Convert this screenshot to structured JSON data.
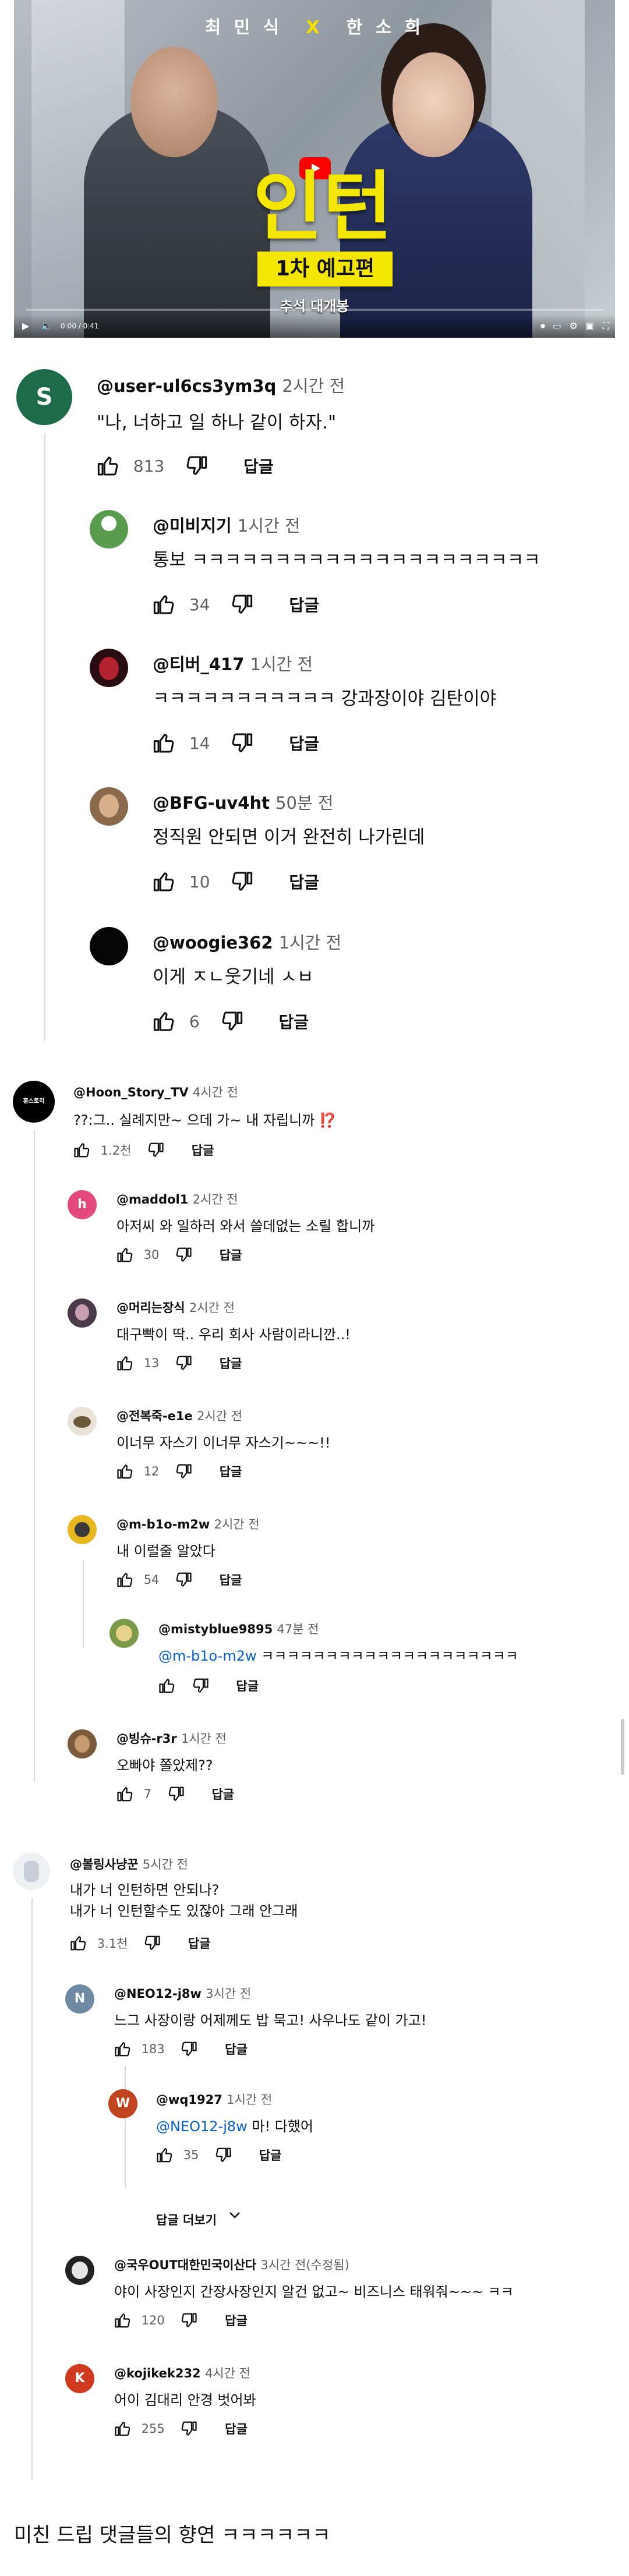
{
  "video": {
    "cast_left": "최 민 식",
    "cast_x": "X",
    "cast_right": "한 소 희",
    "title": "인턴",
    "subtitle": "1차 예고편",
    "caption": "추석 대개봉",
    "time": "0:00 / 0:41"
  },
  "section1": {
    "top": {
      "author": "@user-ul6cs3ym3q",
      "time": "2시간 전",
      "text": "\"나, 너하고 일 하나 같이 하자.\"",
      "likes": "813",
      "reply": "답글"
    },
    "replies": [
      {
        "author": "@미비지기",
        "time": "1시간 전",
        "text": "통보 ㅋㅋㅋㅋㅋㅋㅋㅋㅋㅋㅋㅋㅋㅋㅋㅋㅋㅋㅋㅋㅋ",
        "likes": "34",
        "reply": "답글"
      },
      {
        "author": "@티버_417",
        "time": "1시간 전",
        "text": "ㅋㅋㅋㅋㅋㅋㅋㅋㅋㅋㅋ 강과장이야 김탄이야",
        "likes": "14",
        "reply": "답글"
      },
      {
        "author": "@BFG-uv4ht",
        "time": "50분 전",
        "text": "정직원 안되면 이거 완전히 나가린데",
        "likes": "10",
        "reply": "답글"
      },
      {
        "author": "@woogie362",
        "time": "1시간 전",
        "text": "이게 ㅈㄴ웃기네 ㅅㅂ",
        "likes": "6",
        "reply": "답글"
      }
    ]
  },
  "section2": {
    "top": {
      "author": "@Hoon_Story_TV",
      "time": "4시간 전",
      "text": "??:그.. 실례지만~ 으데 가~ 내 자립니까",
      "emoji": "⁉️",
      "likes": "1.2천",
      "reply": "답글",
      "avatar_text": "훈스토리"
    },
    "replies": [
      {
        "author": "@maddol1",
        "time": "2시간 전",
        "text": "아저씨 와 일하러 와서 쓸데없는 소릴 합니까",
        "likes": "30",
        "reply": "답글",
        "initial": "h"
      },
      {
        "author": "@머리는장식",
        "time": "2시간 전",
        "text": "대구빡이 딱.. 우리 회사 사람이라니깐..!",
        "likes": "13",
        "reply": "답글"
      },
      {
        "author": "@전복죽-e1e",
        "time": "2시간 전",
        "text": "이너무 자스기 이너무 자스기~~~!!",
        "likes": "12",
        "reply": "답글"
      },
      {
        "author": "@m-b1o-m2w",
        "time": "2시간 전",
        "text": "내 이럴줄 알았다",
        "likes": "54",
        "reply": "답글"
      }
    ],
    "nested": {
      "author": "@mistyblue9895",
      "time": "47분 전",
      "mention": "@m-b1o-m2w",
      "text": "ㅋㅋㅋㅋㅋㅋㅋㅋㅋㅋㅋㅋㅋㅋㅋㅋㅋㅋㅋㅋ",
      "reply": "답글"
    },
    "last": {
      "author": "@빙슈-r3r",
      "time": "1시간 전",
      "text": "오빠야 쫄았제??",
      "likes": "7",
      "reply": "답글"
    }
  },
  "section3": {
    "top": {
      "author": "@볼링사냥꾼",
      "time": "5시간 전",
      "line1": "내가 너 인턴하면 안되나?",
      "line2": "내가 너 인턴할수도 있잖아 그래 안그래",
      "likes": "3.1천",
      "reply": "답글"
    },
    "r1": {
      "author": "@NEO12-j8w",
      "time": "3시간 전",
      "text": "느그 사장이랑 어제께도 밥 묵고! 사우나도 같이 가고!",
      "likes": "183",
      "reply": "답글",
      "initial": "N"
    },
    "r1_nested": {
      "author": "@wq1927",
      "time": "1시간 전",
      "mention": "@NEO12-j8w",
      "text": "마! 다했어",
      "likes": "35",
      "reply": "답글",
      "initial": "W"
    },
    "more_replies": "답글 더보기",
    "r2": {
      "author": "@국우OUT대한민국이산다",
      "time": "3시간 전(수정됨)",
      "text": "야이 사장인지 간장사장인지 알건 없고~ 비즈니스 태워줘~~~ ㅋㅋ",
      "likes": "120",
      "reply": "답글"
    },
    "r3": {
      "author": "@kojikek232",
      "time": "4시간 전",
      "text": "어이 김대리 안경 벗어봐",
      "likes": "255",
      "reply": "답글",
      "initial": "K"
    }
  },
  "footer": "미친 드립 댓글들의 향연 ㅋㅋㅋㅋㅋㅋ"
}
